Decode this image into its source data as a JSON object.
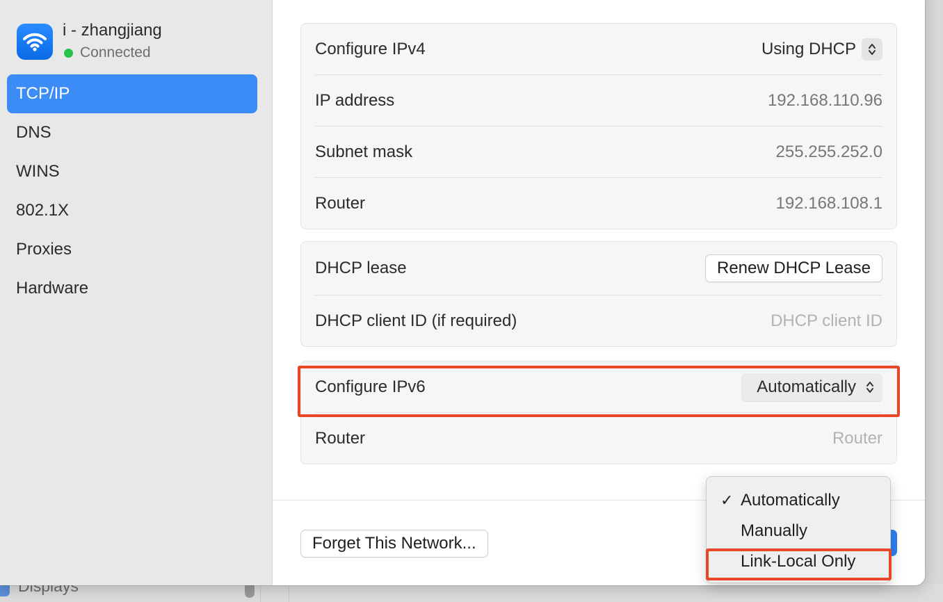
{
  "network": {
    "name": "i - zhangjiang",
    "status": "Connected"
  },
  "sidebar": {
    "items": [
      {
        "label": "TCP/IP",
        "selected": true
      },
      {
        "label": "DNS"
      },
      {
        "label": "WINS"
      },
      {
        "label": "802.1X"
      },
      {
        "label": "Proxies"
      },
      {
        "label": "Hardware"
      }
    ]
  },
  "ipv4": {
    "configure_label": "Configure IPv4",
    "configure_value": "Using DHCP",
    "ip_label": "IP address",
    "ip_value": "192.168.110.96",
    "subnet_label": "Subnet mask",
    "subnet_value": "255.255.252.0",
    "router_label": "Router",
    "router_value": "192.168.108.1"
  },
  "dhcp": {
    "lease_label": "DHCP lease",
    "renew_button": "Renew DHCP Lease",
    "client_id_label": "DHCP client ID (if required)",
    "client_id_placeholder": "DHCP client ID"
  },
  "ipv6": {
    "configure_label": "Configure IPv6",
    "configure_value": "Automatically",
    "router_label": "Router",
    "router_placeholder": "Router"
  },
  "footer": {
    "forget_button": "Forget This Network..."
  },
  "ipv6_menu": {
    "options": [
      "Automatically",
      "Manually",
      "Link-Local Only"
    ],
    "checkmark": "✓"
  },
  "background": {
    "displays_label": "Displays"
  },
  "colors": {
    "accent": "#3b8cf6",
    "highlight": "#e8482a",
    "status": "#29c24a"
  }
}
